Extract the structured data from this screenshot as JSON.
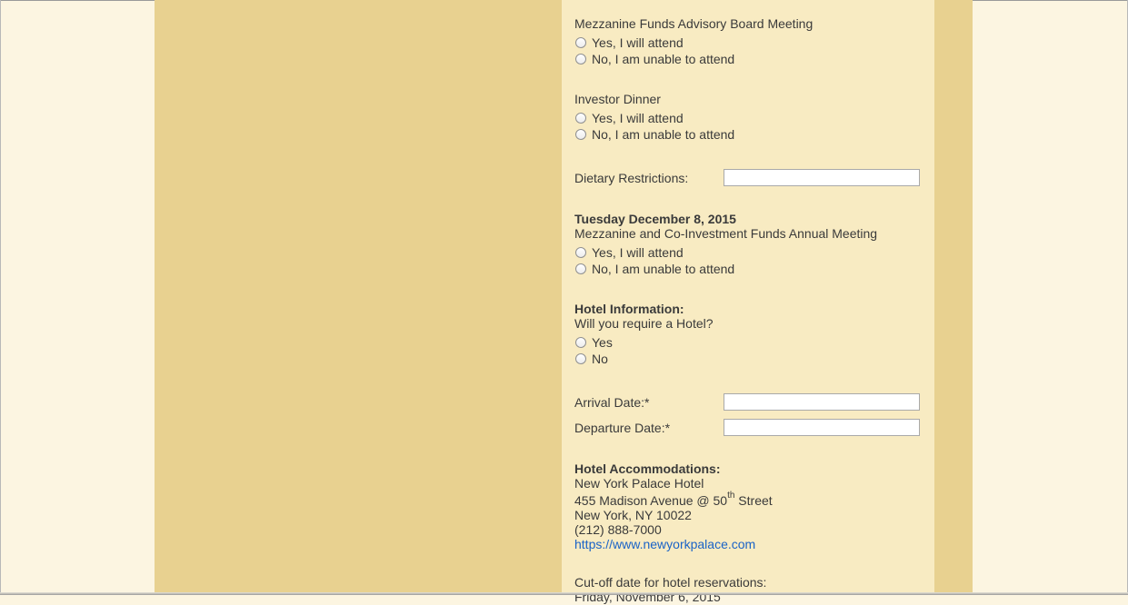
{
  "mezzanine_board": {
    "title": "Mezzanine Funds Advisory Board Meeting",
    "yes": "Yes, I will attend",
    "no": "No, I am unable to attend"
  },
  "investor_dinner": {
    "title": "Investor Dinner",
    "yes": "Yes, I will attend",
    "no": "No, I am unable to attend"
  },
  "dietary": {
    "label": "Dietary Restrictions:",
    "value": ""
  },
  "annual_meeting": {
    "date_heading": "Tuesday December 8, 2015",
    "title": "Mezzanine and Co-Investment Funds Annual Meeting",
    "yes": "Yes, I will attend",
    "no": "No, I am unable to attend"
  },
  "hotel_info": {
    "heading": "Hotel Information:",
    "question": "Will you require a Hotel?",
    "yes": "Yes",
    "no": "No"
  },
  "dates": {
    "arrival_label": "Arrival Date:*",
    "arrival_value": "",
    "departure_label": "Departure Date:*",
    "departure_value": ""
  },
  "accommodations": {
    "heading": "Hotel Accommodations:",
    "hotel_name": "New York Palace Hotel",
    "address_prefix": "455 Madison Avenue @ 50",
    "address_sup": "th",
    "address_suffix": " Street",
    "city": "New York, NY 10022",
    "phone": "(212) 888-7000",
    "website": "https://www.newyorkpalace.com"
  },
  "cutoff": {
    "label": "Cut-off date for hotel reservations:",
    "date": "Friday, November 6, 2015"
  },
  "colors": {
    "page_background": "#fcf5e1",
    "panel": "#e8d190",
    "content": "#f8ebc2",
    "link": "#1a63c7"
  }
}
